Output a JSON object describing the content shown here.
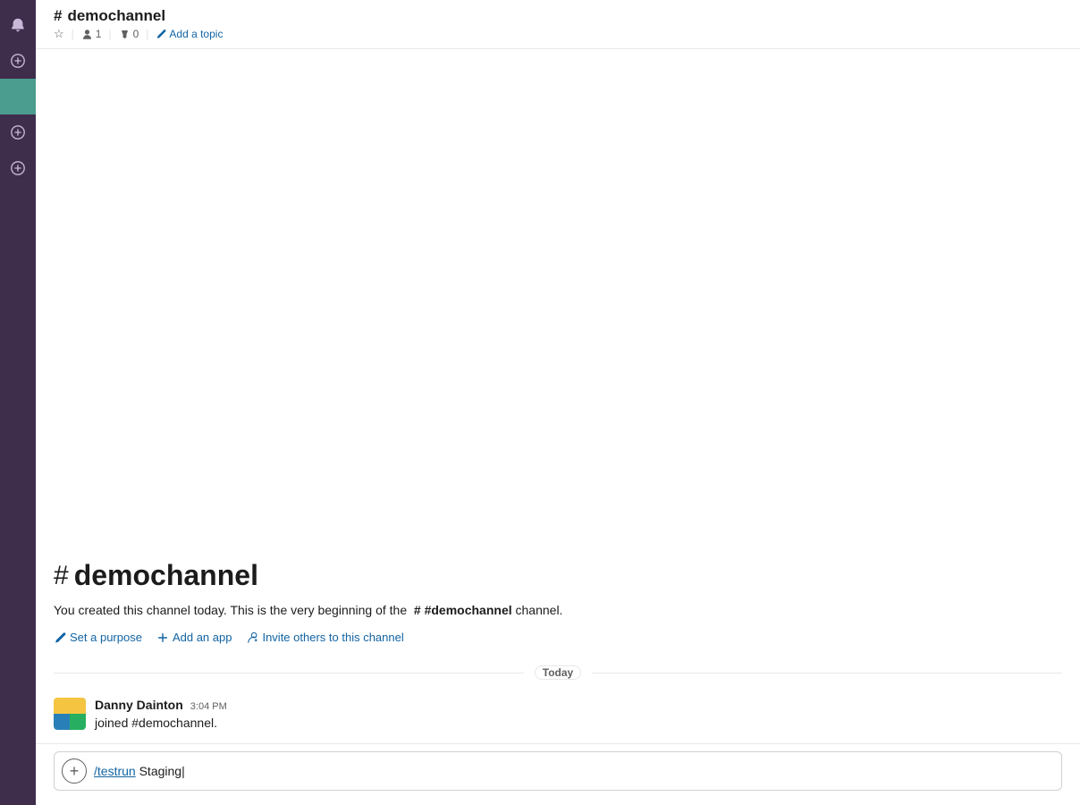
{
  "sidebar": {
    "icons": [
      {
        "name": "bell-icon",
        "symbol": "🔔",
        "active": false
      },
      {
        "name": "plus-circle-1",
        "symbol": "+",
        "active": false
      },
      {
        "name": "active-item",
        "symbol": "",
        "active": true
      },
      {
        "name": "plus-circle-2",
        "symbol": "+",
        "active": false
      },
      {
        "name": "plus-circle-3",
        "symbol": "+",
        "active": false
      }
    ]
  },
  "header": {
    "channel_name": "demochannel",
    "star_label": "★",
    "members_count": "1",
    "pins_count": "0",
    "add_topic_label": "Add a topic",
    "pipe_separator": "|"
  },
  "channel_intro": {
    "hash": "#",
    "title": "demochannel",
    "description_parts": {
      "before": "You created this channel today. This is the very beginning of the",
      "channel_mention": "#demochannel",
      "after": "channel."
    },
    "actions": {
      "set_purpose": "Set a purpose",
      "add_app": "Add an app",
      "invite_others": "Invite others to this channel"
    }
  },
  "divider": {
    "label": "Today"
  },
  "messages": [
    {
      "author": "Danny Dainton",
      "time": "3:04 PM",
      "body": "joined #demochannel."
    }
  ],
  "message_input": {
    "plus_label": "+",
    "command": "/testrun",
    "command_text": " Staging",
    "cursor": true
  }
}
